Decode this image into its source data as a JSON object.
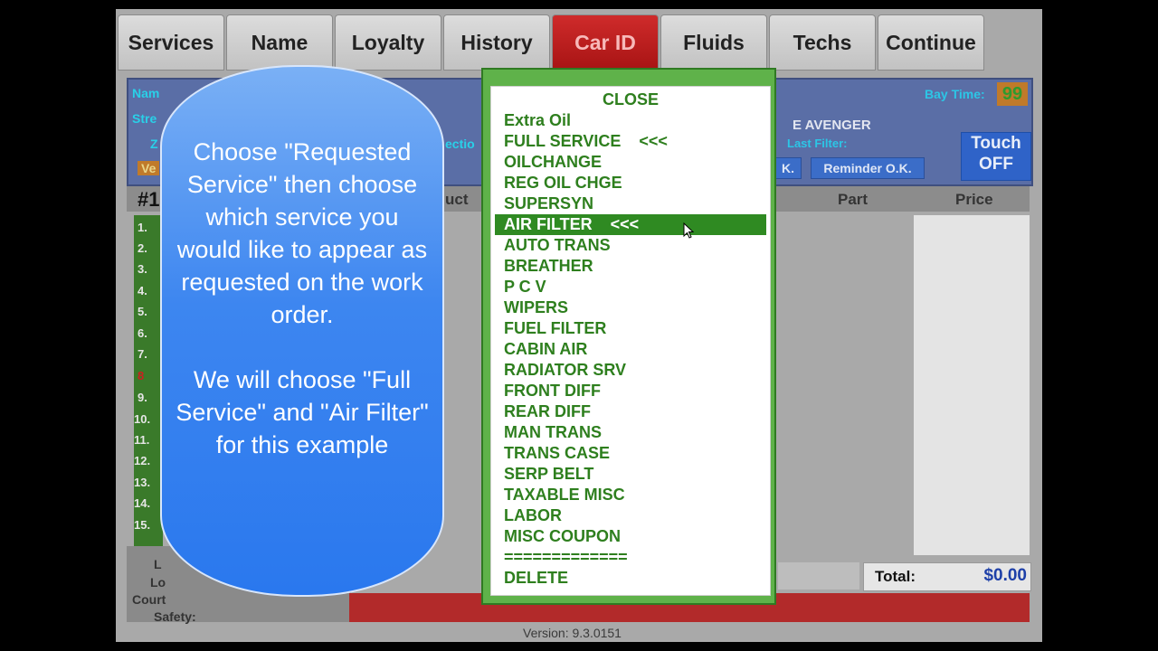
{
  "tabs": [
    {
      "label": "Services",
      "active": false
    },
    {
      "label": "Name",
      "active": false
    },
    {
      "label": "Loyalty",
      "active": false
    },
    {
      "label": "History",
      "active": false
    },
    {
      "label": "Car ID",
      "active": true
    },
    {
      "label": "Fluids",
      "active": false
    },
    {
      "label": "Techs",
      "active": false
    },
    {
      "label": "Continue",
      "active": false
    }
  ],
  "info_panel": {
    "name_label": "Nam",
    "street_label": "Stre",
    "zip_label": "Z",
    "vehicle_label": "Ve",
    "direction_label": "ectio",
    "vehicle_name": "E AVENGER",
    "bay_time_label": "Bay Time:",
    "bay_time_value": "99",
    "last_filter_label": "Last Filter:",
    "ok_label": "K.",
    "reminder_label": "Reminder O.K.",
    "touch_line1": "Touch",
    "touch_line2": "OFF"
  },
  "table_header": {
    "num": "#1",
    "product": "uct",
    "part": "Part",
    "price": "Price"
  },
  "row_numbers": [
    "1.",
    "2.",
    "3.",
    "4.",
    "5.",
    "6.",
    "7.",
    "8",
    "9.",
    "10.",
    "11.",
    "12.",
    "13.",
    "14.",
    "15."
  ],
  "bottom": {
    "label_l1": "L",
    "label_l2": "Lo",
    "courtesy_label": "Court",
    "safety_label": "Safety:",
    "total_label": "Total:",
    "total_value": "$0.00",
    "version": "Version: 9.3.0151"
  },
  "tutorial_bubble": {
    "line1": "Choose \"Requested Service\" then choose which service you would like to appear as requested on the work order.",
    "line2": "We will choose \"Full Service\" and \"Air Filter\" for this example"
  },
  "menu": {
    "close_label": "CLOSE",
    "items": [
      {
        "label": "Extra Oil",
        "selected": false
      },
      {
        "label": "FULL SERVICE    <<<",
        "selected": false
      },
      {
        "label": "OILCHANGE",
        "selected": false
      },
      {
        "label": "REG OIL CHGE",
        "selected": false
      },
      {
        "label": "SUPERSYN",
        "selected": false
      },
      {
        "label": "AIR FILTER    <<<",
        "selected": true
      },
      {
        "label": "AUTO TRANS",
        "selected": false
      },
      {
        "label": "BREATHER",
        "selected": false
      },
      {
        "label": "P C V",
        "selected": false
      },
      {
        "label": "WIPERS",
        "selected": false
      },
      {
        "label": "FUEL FILTER",
        "selected": false
      },
      {
        "label": "CABIN AIR",
        "selected": false
      },
      {
        "label": "RADIATOR SRV",
        "selected": false
      },
      {
        "label": "FRONT DIFF",
        "selected": false
      },
      {
        "label": "REAR DIFF",
        "selected": false
      },
      {
        "label": "MAN TRANS",
        "selected": false
      },
      {
        "label": "TRANS CASE",
        "selected": false
      },
      {
        "label": "SERP BELT",
        "selected": false
      },
      {
        "label": "TAXABLE MISC",
        "selected": false
      },
      {
        "label": "LABOR",
        "selected": false
      },
      {
        "label": "MISC COUPON",
        "selected": false
      },
      {
        "label": "=============",
        "selected": false
      },
      {
        "label": "DELETE",
        "selected": false
      }
    ]
  }
}
